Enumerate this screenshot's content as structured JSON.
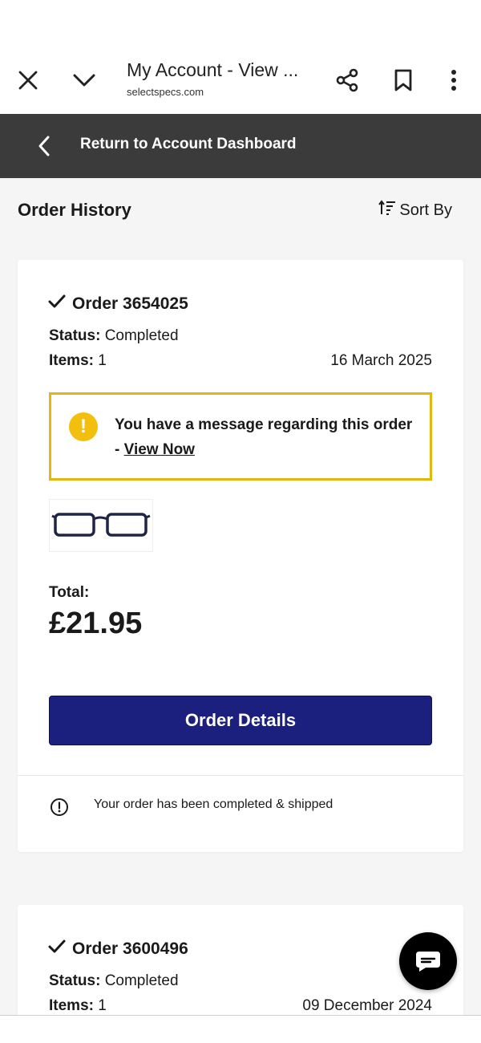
{
  "browser": {
    "title": "My Account - View ...",
    "url": "selectspecs.com",
    "icons": [
      "close-icon",
      "chevron-down-icon",
      "share-icon",
      "bookmark-icon",
      "more-vertical-icon"
    ]
  },
  "nav": {
    "return_label": "Return to Account Dashboard"
  },
  "history": {
    "title": "Order History",
    "sort_label": "Sort By"
  },
  "orders": [
    {
      "order_label": "Order 3654025",
      "status_label": "Status:",
      "status_value": "Completed",
      "items_label": "Items:",
      "items_value": "1",
      "date": "16 March 2025",
      "message_text": "You have a message regarding this order - ",
      "message_link": "View Now",
      "total_label": "Total:",
      "total_value": "£21.95",
      "details_button": "Order Details",
      "info_text": "Your order has been completed & shipped"
    },
    {
      "order_label": "Order 3600496",
      "status_label": "Status:",
      "status_value": "Completed",
      "items_label": "Items:",
      "items_value": "1",
      "date": "09 December 2024"
    }
  ],
  "colors": {
    "header_dark": "#3b3b3b",
    "button_navy": "#1b1f7d",
    "warning_yellow": "#e3b70d"
  }
}
